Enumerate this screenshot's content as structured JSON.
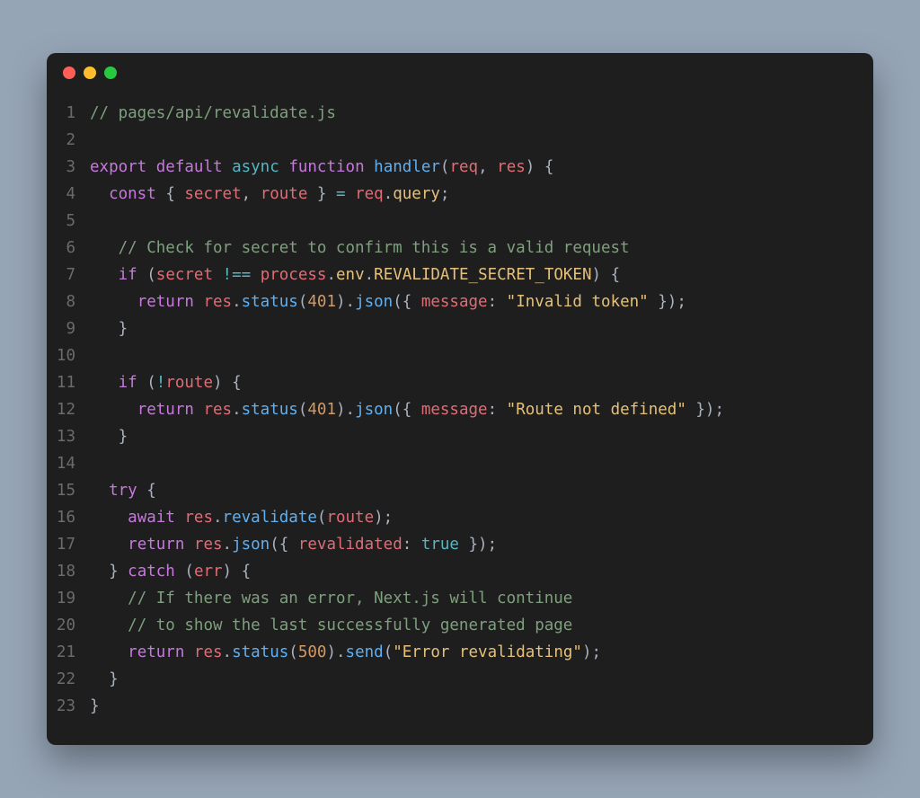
{
  "window": {
    "traffic_lights": [
      "red",
      "yellow",
      "green"
    ]
  },
  "code": {
    "lines": [
      {
        "n": "1",
        "tokens": [
          [
            "cm",
            "// pages/api/revalidate.js"
          ]
        ]
      },
      {
        "n": "2",
        "tokens": []
      },
      {
        "n": "3",
        "tokens": [
          [
            "kw",
            "export"
          ],
          [
            "pl",
            " "
          ],
          [
            "kw",
            "default"
          ],
          [
            "pl",
            " "
          ],
          [
            "kw2",
            "async"
          ],
          [
            "pl",
            " "
          ],
          [
            "kw",
            "function"
          ],
          [
            "pl",
            " "
          ],
          [
            "fn",
            "handler"
          ],
          [
            "pn",
            "("
          ],
          [
            "id",
            "req"
          ],
          [
            "pn",
            ", "
          ],
          [
            "id",
            "res"
          ],
          [
            "pn",
            ") {"
          ]
        ]
      },
      {
        "n": "4",
        "tokens": [
          [
            "pl",
            "  "
          ],
          [
            "kw",
            "const"
          ],
          [
            "pl",
            " "
          ],
          [
            "pn",
            "{ "
          ],
          [
            "id",
            "secret"
          ],
          [
            "pn",
            ", "
          ],
          [
            "id",
            "route"
          ],
          [
            "pn",
            " } "
          ],
          [
            "op",
            "="
          ],
          [
            "pl",
            " "
          ],
          [
            "id",
            "req"
          ],
          [
            "pn",
            "."
          ],
          [
            "pr",
            "query"
          ],
          [
            "pn",
            ";"
          ]
        ]
      },
      {
        "n": "5",
        "tokens": []
      },
      {
        "n": "6",
        "tokens": [
          [
            "pl",
            "   "
          ],
          [
            "cm",
            "// Check for secret to confirm this is a valid request"
          ]
        ]
      },
      {
        "n": "7",
        "tokens": [
          [
            "pl",
            "   "
          ],
          [
            "kw",
            "if"
          ],
          [
            "pl",
            " "
          ],
          [
            "pn",
            "("
          ],
          [
            "id",
            "secret"
          ],
          [
            "pl",
            " "
          ],
          [
            "op",
            "!=="
          ],
          [
            "pl",
            " "
          ],
          [
            "id",
            "process"
          ],
          [
            "pn",
            "."
          ],
          [
            "pr",
            "env"
          ],
          [
            "pn",
            "."
          ],
          [
            "pr",
            "REVALIDATE_SECRET_TOKEN"
          ],
          [
            "pn",
            ") {"
          ]
        ]
      },
      {
        "n": "8",
        "tokens": [
          [
            "pl",
            "     "
          ],
          [
            "kw",
            "return"
          ],
          [
            "pl",
            " "
          ],
          [
            "id",
            "res"
          ],
          [
            "pn",
            "."
          ],
          [
            "fn",
            "status"
          ],
          [
            "pn",
            "("
          ],
          [
            "num",
            "401"
          ],
          [
            "pn",
            ")."
          ],
          [
            "fn",
            "json"
          ],
          [
            "pn",
            "({ "
          ],
          [
            "id",
            "message"
          ],
          [
            "pn",
            ": "
          ],
          [
            "str",
            "\"Invalid token\""
          ],
          [
            "pn",
            " });"
          ]
        ]
      },
      {
        "n": "9",
        "tokens": [
          [
            "pl",
            "   "
          ],
          [
            "pn",
            "}"
          ]
        ]
      },
      {
        "n": "10",
        "tokens": []
      },
      {
        "n": "11",
        "tokens": [
          [
            "pl",
            "   "
          ],
          [
            "kw",
            "if"
          ],
          [
            "pl",
            " "
          ],
          [
            "pn",
            "("
          ],
          [
            "op",
            "!"
          ],
          [
            "id",
            "route"
          ],
          [
            "pn",
            ") {"
          ]
        ]
      },
      {
        "n": "12",
        "tokens": [
          [
            "pl",
            "     "
          ],
          [
            "kw",
            "return"
          ],
          [
            "pl",
            " "
          ],
          [
            "id",
            "res"
          ],
          [
            "pn",
            "."
          ],
          [
            "fn",
            "status"
          ],
          [
            "pn",
            "("
          ],
          [
            "num",
            "401"
          ],
          [
            "pn",
            ")."
          ],
          [
            "fn",
            "json"
          ],
          [
            "pn",
            "({ "
          ],
          [
            "id",
            "message"
          ],
          [
            "pn",
            ": "
          ],
          [
            "str",
            "\"Route not defined\""
          ],
          [
            "pn",
            " });"
          ]
        ]
      },
      {
        "n": "13",
        "tokens": [
          [
            "pl",
            "   "
          ],
          [
            "pn",
            "}"
          ]
        ]
      },
      {
        "n": "14",
        "tokens": []
      },
      {
        "n": "15",
        "tokens": [
          [
            "pl",
            "  "
          ],
          [
            "kw",
            "try"
          ],
          [
            "pl",
            " "
          ],
          [
            "pn",
            "{"
          ]
        ]
      },
      {
        "n": "16",
        "tokens": [
          [
            "pl",
            "    "
          ],
          [
            "kw",
            "await"
          ],
          [
            "pl",
            " "
          ],
          [
            "id",
            "res"
          ],
          [
            "pn",
            "."
          ],
          [
            "fn",
            "revalidate"
          ],
          [
            "pn",
            "("
          ],
          [
            "id",
            "route"
          ],
          [
            "pn",
            ");"
          ]
        ]
      },
      {
        "n": "17",
        "tokens": [
          [
            "pl",
            "    "
          ],
          [
            "kw",
            "return"
          ],
          [
            "pl",
            " "
          ],
          [
            "id",
            "res"
          ],
          [
            "pn",
            "."
          ],
          [
            "fn",
            "json"
          ],
          [
            "pn",
            "({ "
          ],
          [
            "id",
            "revalidated"
          ],
          [
            "pn",
            ": "
          ],
          [
            "bl",
            "true"
          ],
          [
            "pn",
            " });"
          ]
        ]
      },
      {
        "n": "18",
        "tokens": [
          [
            "pl",
            "  "
          ],
          [
            "pn",
            "} "
          ],
          [
            "kw",
            "catch"
          ],
          [
            "pl",
            " "
          ],
          [
            "pn",
            "("
          ],
          [
            "id",
            "err"
          ],
          [
            "pn",
            ") {"
          ]
        ]
      },
      {
        "n": "19",
        "tokens": [
          [
            "pl",
            "    "
          ],
          [
            "cm",
            "// If there was an error, Next.js will continue"
          ]
        ]
      },
      {
        "n": "20",
        "tokens": [
          [
            "pl",
            "    "
          ],
          [
            "cm",
            "// to show the last successfully generated page"
          ]
        ]
      },
      {
        "n": "21",
        "tokens": [
          [
            "pl",
            "    "
          ],
          [
            "kw",
            "return"
          ],
          [
            "pl",
            " "
          ],
          [
            "id",
            "res"
          ],
          [
            "pn",
            "."
          ],
          [
            "fn",
            "status"
          ],
          [
            "pn",
            "("
          ],
          [
            "num",
            "500"
          ],
          [
            "pn",
            ")."
          ],
          [
            "fn",
            "send"
          ],
          [
            "pn",
            "("
          ],
          [
            "str",
            "\"Error revalidating\""
          ],
          [
            "pn",
            ");"
          ]
        ]
      },
      {
        "n": "22",
        "tokens": [
          [
            "pl",
            "  "
          ],
          [
            "pn",
            "}"
          ]
        ]
      },
      {
        "n": "23",
        "tokens": [
          [
            "pn",
            "}"
          ]
        ]
      }
    ]
  }
}
